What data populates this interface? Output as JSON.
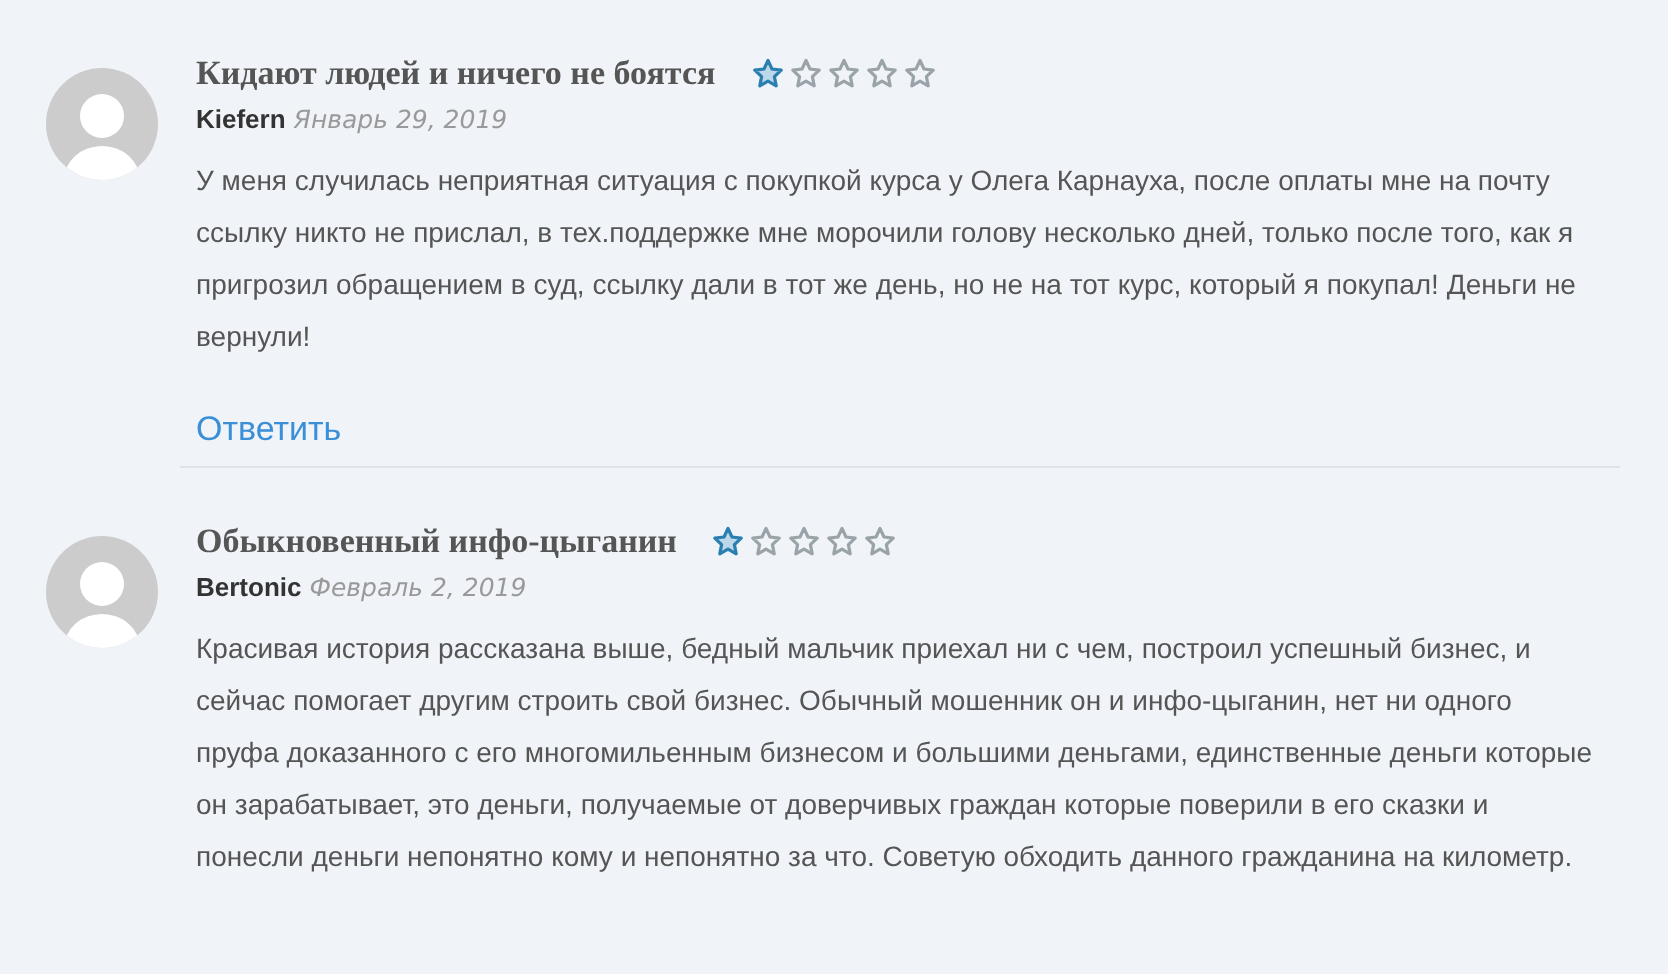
{
  "reviews": [
    {
      "title": "Кидают людей и ничего не боятся",
      "stars": 1,
      "author": "Kiefern",
      "date": "Январь 29, 2019",
      "text": "У меня случилась неприятная ситуация с покупкой курса у Олега Карнауха, после оплаты мне на почту ссылку никто не прислал, в тех.поддержке мне морочили голову несколько дней, только после того, как я пригрозил обращением в суд, ссылку дали в тот же день, но не на тот курс, который я покупал! Деньги не вернули!",
      "reply": "Ответить"
    },
    {
      "title": "Обыкновенный инфо-цыганин",
      "stars": 1,
      "author": "Bertonic",
      "date": "Февраль 2, 2019",
      "text": "Красивая история рассказана выше, бедный мальчик приехал ни с чем, построил успешный бизнес, и сейчас помогает другим строить свой бизнес. Обычный мошенник он и инфо-цыганин, нет ни одного пруфа доказанного с его многомильенным бизнесом и большими деньгами, единственные деньги которые он зарабатывает, это деньги, получаемые от доверчивых граждан которые поверили в его сказки и понесли деньги непонятно кому и непонятно за что. Советую обходить данного гражданина на километр."
    }
  ]
}
